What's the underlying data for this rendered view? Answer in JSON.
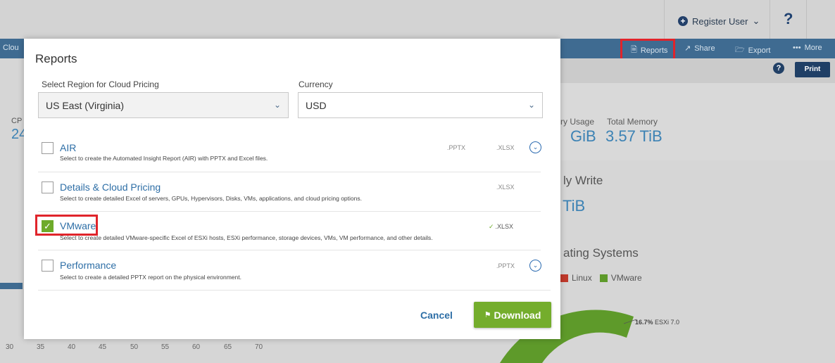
{
  "topbar": {
    "register_user": "Register User",
    "register_icon": "plus-circle-icon",
    "help": "?"
  },
  "toolbar": {
    "cloud_fragment": "Clou",
    "reports": "Reports",
    "share": "Share",
    "export": "Export",
    "more": "More",
    "help": "?",
    "print": "Print"
  },
  "background": {
    "left_label_fragment": "CP",
    "left_value_fragment": "24",
    "memory_usage_label": "ry Usage",
    "memory_usage_value": "GiB",
    "total_memory_label": "Total Memory",
    "total_memory_value": "3.57 TiB",
    "write_label": "ly Write",
    "write_value": "TiB",
    "os_title": "ating Systems",
    "legend": [
      {
        "label": "Linux",
        "color": "#c0392b"
      },
      {
        "label": "VMware",
        "color": "#5e9a2a"
      }
    ],
    "pie_label_bold": "16.7%",
    "pie_label_rest": "ESXi 7.0",
    "axis_ticks": [
      "30",
      "35",
      "40",
      "45",
      "50",
      "55",
      "60",
      "65",
      "70"
    ]
  },
  "modal": {
    "title": "Reports",
    "region_label": "Select Region for Cloud Pricing",
    "region_value": "US East (Virginia)",
    "currency_label": "Currency",
    "currency_value": "USD",
    "options": [
      {
        "title": "AIR",
        "desc": "Select to create the Automated Insight Report (AIR) with PPTX and Excel files.",
        "formats": [
          ".PPTX",
          ".XLSX"
        ],
        "checked": false,
        "expand": true
      },
      {
        "title": "Details & Cloud Pricing",
        "desc": "Select to create detailed Excel of servers, GPUs, Hypervisors, Disks, VMs, applications, and cloud pricing options.",
        "formats": [
          ".XLSX"
        ],
        "checked": false,
        "expand": false
      },
      {
        "title": "VMware",
        "desc": "Select to create detailed VMware-specific Excel of ESXi hosts, ESXi performance, storage devices, VMs, VM performance, and other details.",
        "formats": [
          ".XLSX"
        ],
        "checked": true,
        "expand": false
      },
      {
        "title": "Performance",
        "desc": "Select to create a detailed PPTX report on the physical environment.",
        "formats": [
          ".PPTX"
        ],
        "checked": false,
        "expand": true
      }
    ],
    "cancel": "Cancel",
    "download": "Download"
  },
  "colors": {
    "accent_blue": "#2d6ea6",
    "toolbar_blue": "#3f6b91",
    "download_green": "#74ad2c",
    "highlight_red": "#e0242b"
  }
}
